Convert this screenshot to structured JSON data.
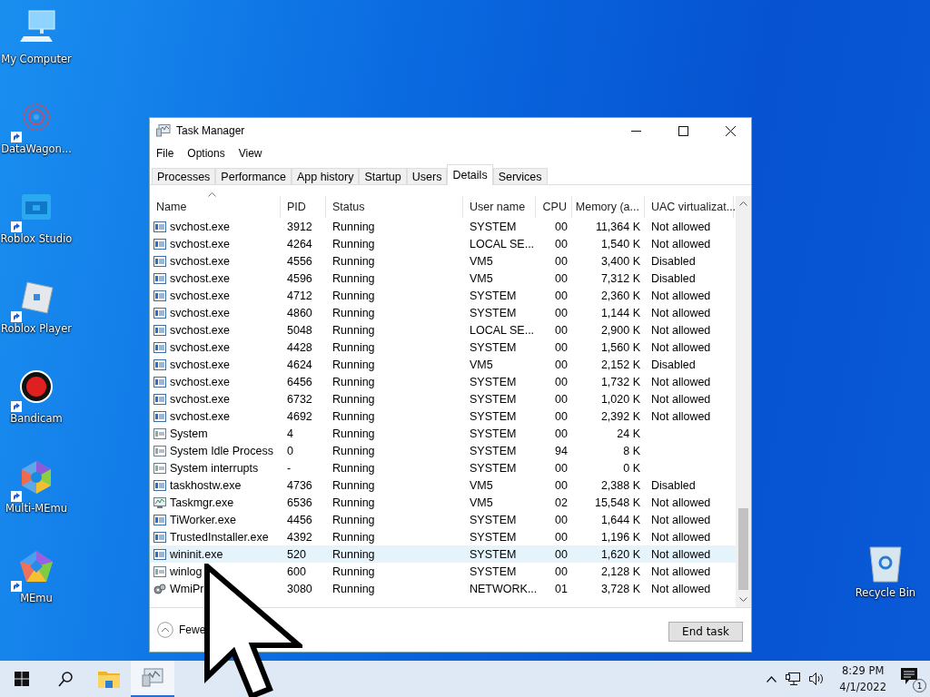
{
  "desktop_icons": [
    {
      "label": "My Computer",
      "kind": "computer",
      "shortcut": false
    },
    {
      "label": "DataWagon...",
      "kind": "web",
      "shortcut": true
    },
    {
      "label": "Roblox Studio",
      "kind": "studio",
      "shortcut": true
    },
    {
      "label": "Roblox Player",
      "kind": "player",
      "shortcut": true
    },
    {
      "label": "Bandicam",
      "kind": "record",
      "shortcut": true
    },
    {
      "label": "Multi-MEmu",
      "kind": "multimemu",
      "shortcut": true
    },
    {
      "label": "MEmu",
      "kind": "memu",
      "shortcut": true
    }
  ],
  "recycle_bin": {
    "label": "Recycle Bin"
  },
  "window": {
    "title": "Task Manager",
    "menu": [
      "File",
      "Options",
      "View"
    ],
    "tabs": [
      {
        "label": "Processes",
        "selected": false
      },
      {
        "label": "Performance",
        "selected": false
      },
      {
        "label": "App history",
        "selected": false
      },
      {
        "label": "Startup",
        "selected": false
      },
      {
        "label": "Users",
        "selected": false
      },
      {
        "label": "Details",
        "selected": true
      },
      {
        "label": "Services",
        "selected": false
      }
    ],
    "table": {
      "columns": [
        "Name",
        "PID",
        "Status",
        "User name",
        "CPU",
        "Memory (a...",
        "UAC virtualizat..."
      ],
      "rows": [
        {
          "kind": "service",
          "name": "svchost.exe",
          "pid": "3912",
          "status": "Running",
          "user": "SYSTEM",
          "cpu": "00",
          "memory": "11,364 K",
          "uac": "Not allowed",
          "selected": false
        },
        {
          "kind": "service",
          "name": "svchost.exe",
          "pid": "4264",
          "status": "Running",
          "user": "LOCAL SE...",
          "cpu": "00",
          "memory": "1,540 K",
          "uac": "Not allowed",
          "selected": false
        },
        {
          "kind": "service",
          "name": "svchost.exe",
          "pid": "4556",
          "status": "Running",
          "user": "VM5",
          "cpu": "00",
          "memory": "3,400 K",
          "uac": "Disabled",
          "selected": false
        },
        {
          "kind": "service",
          "name": "svchost.exe",
          "pid": "4596",
          "status": "Running",
          "user": "VM5",
          "cpu": "00",
          "memory": "7,312 K",
          "uac": "Disabled",
          "selected": false
        },
        {
          "kind": "service",
          "name": "svchost.exe",
          "pid": "4712",
          "status": "Running",
          "user": "SYSTEM",
          "cpu": "00",
          "memory": "2,360 K",
          "uac": "Not allowed",
          "selected": false
        },
        {
          "kind": "service",
          "name": "svchost.exe",
          "pid": "4860",
          "status": "Running",
          "user": "SYSTEM",
          "cpu": "00",
          "memory": "1,144 K",
          "uac": "Not allowed",
          "selected": false
        },
        {
          "kind": "service",
          "name": "svchost.exe",
          "pid": "5048",
          "status": "Running",
          "user": "LOCAL SE...",
          "cpu": "00",
          "memory": "2,900 K",
          "uac": "Not allowed",
          "selected": false
        },
        {
          "kind": "service",
          "name": "svchost.exe",
          "pid": "4428",
          "status": "Running",
          "user": "SYSTEM",
          "cpu": "00",
          "memory": "1,560 K",
          "uac": "Not allowed",
          "selected": false
        },
        {
          "kind": "service",
          "name": "svchost.exe",
          "pid": "4624",
          "status": "Running",
          "user": "VM5",
          "cpu": "00",
          "memory": "2,152 K",
          "uac": "Disabled",
          "selected": false
        },
        {
          "kind": "service",
          "name": "svchost.exe",
          "pid": "6456",
          "status": "Running",
          "user": "SYSTEM",
          "cpu": "00",
          "memory": "1,732 K",
          "uac": "Not allowed",
          "selected": false
        },
        {
          "kind": "service",
          "name": "svchost.exe",
          "pid": "6732",
          "status": "Running",
          "user": "SYSTEM",
          "cpu": "00",
          "memory": "1,020 K",
          "uac": "Not allowed",
          "selected": false
        },
        {
          "kind": "service",
          "name": "svchost.exe",
          "pid": "4692",
          "status": "Running",
          "user": "SYSTEM",
          "cpu": "00",
          "memory": "2,392 K",
          "uac": "Not allowed",
          "selected": false
        },
        {
          "kind": "plain",
          "name": "System",
          "pid": "4",
          "status": "Running",
          "user": "SYSTEM",
          "cpu": "00",
          "memory": "24 K",
          "selected": false
        },
        {
          "kind": "plain",
          "name": "System Idle Process",
          "pid": "0",
          "status": "Running",
          "user": "SYSTEM",
          "cpu": "94",
          "memory": "8 K",
          "selected": false
        },
        {
          "kind": "plain",
          "name": "System interrupts",
          "pid": "-",
          "status": "Running",
          "user": "SYSTEM",
          "cpu": "00",
          "memory": "0 K",
          "selected": false
        },
        {
          "kind": "service",
          "name": "taskhostw.exe",
          "pid": "4736",
          "status": "Running",
          "user": "VM5",
          "cpu": "00",
          "memory": "2,388 K",
          "uac": "Disabled",
          "selected": false
        },
        {
          "kind": "monitor",
          "name": "Taskmgr.exe",
          "pid": "6536",
          "status": "Running",
          "user": "VM5",
          "cpu": "02",
          "memory": "15,548 K",
          "uac": "Not allowed",
          "selected": false
        },
        {
          "kind": "service",
          "name": "TiWorker.exe",
          "pid": "4456",
          "status": "Running",
          "user": "SYSTEM",
          "cpu": "00",
          "memory": "1,644 K",
          "uac": "Not allowed",
          "selected": false
        },
        {
          "kind": "service",
          "name": "TrustedInstaller.exe",
          "pid": "4392",
          "status": "Running",
          "user": "SYSTEM",
          "cpu": "00",
          "memory": "1,196 K",
          "uac": "Not allowed",
          "selected": false
        },
        {
          "kind": "service",
          "name": "wininit.exe",
          "pid": "520",
          "status": "Running",
          "user": "SYSTEM",
          "cpu": "00",
          "memory": "1,620 K",
          "uac": "Not allowed",
          "selected": true
        },
        {
          "kind": "plain",
          "name": "winlog",
          "pid": "600",
          "status": "Running",
          "user": "SYSTEM",
          "cpu": "00",
          "memory": "2,128 K",
          "uac": "Not allowed",
          "selected": false
        },
        {
          "kind": "gears",
          "name": "WmiPr",
          "pid": "3080",
          "status": "Running",
          "user": "NETWORK...",
          "cpu": "01",
          "memory": "3,728 K",
          "uac": "Not allowed",
          "selected": false
        }
      ]
    },
    "details_toggle": "Fewe",
    "end_task": "End task"
  },
  "taskbar": {
    "apps": [
      {
        "kind": "start",
        "active": false
      },
      {
        "kind": "search",
        "active": false
      },
      {
        "kind": "folder",
        "active": false
      },
      {
        "kind": "taskmgr",
        "active": true
      }
    ],
    "time": "8:29 PM",
    "date": "4/1/2022",
    "notification_count": "1"
  }
}
